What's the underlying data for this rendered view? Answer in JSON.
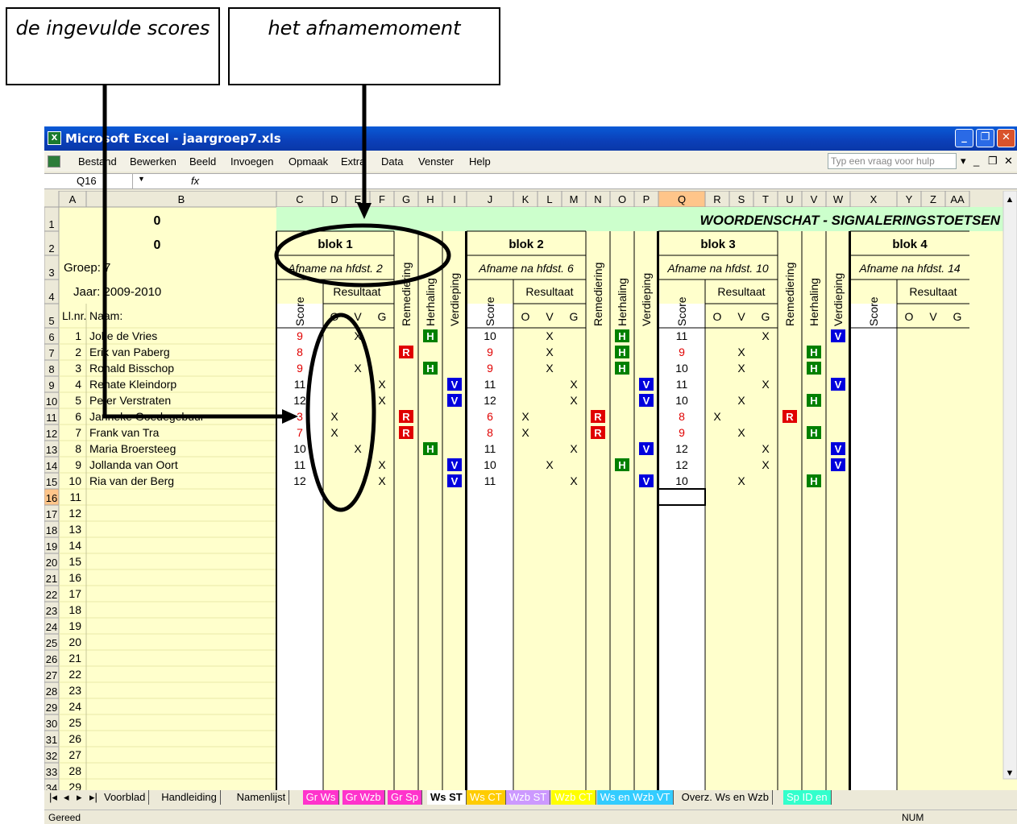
{
  "callouts": {
    "left": "de ingevulde scores",
    "right": "het afnamemoment"
  },
  "window": {
    "title": "Microsoft Excel - jaargroep7.xls"
  },
  "menu": [
    "Bestand",
    "Bewerken",
    "Beeld",
    "Invoegen",
    "Opmaak",
    "Extra",
    "Data",
    "Venster",
    "Help"
  ],
  "help_placeholder": "Typ een vraag voor hulp",
  "namebox": "Q16",
  "fx": "fx",
  "columns": [
    "A",
    "B",
    "C",
    "D",
    "E",
    "F",
    "G",
    "H",
    "I",
    "J",
    "K",
    "L",
    "M",
    "N",
    "O",
    "P",
    "Q",
    "R",
    "S",
    "T",
    "U",
    "V",
    "W",
    "X",
    "Y",
    "Z",
    "AA"
  ],
  "sheet": {
    "a1": "0",
    "a2": "0",
    "groep": "Groep: 7",
    "jaar": "Jaar: 2009-2010",
    "llnr": "Ll.nr.",
    "naam": "Naam:",
    "title": "WOORDENSCHAT - SIGNALERINGSTOETSEN",
    "blocks": [
      {
        "name": "blok 1",
        "afname": "Afname na hfdst. 2"
      },
      {
        "name": "blok 2",
        "afname": "Afname na hfdst. 6"
      },
      {
        "name": "blok 3",
        "afname": "Afname na hfdst. 10"
      },
      {
        "name": "blok 4",
        "afname": "Afname na hfdst. 14"
      }
    ],
    "score": "Score",
    "resultaat": "Resultaat",
    "o": "O",
    "v": "V",
    "g": "G",
    "remediering": "Remediering",
    "herhaling": "Herhaling",
    "verdieping": "Verdieping"
  },
  "students": [
    {
      "nr": "1",
      "name": "Joke de Vries",
      "b": [
        [
          "9",
          "V",
          "H"
        ],
        [
          "10",
          "V",
          "H"
        ],
        [
          "11",
          "G",
          "V"
        ]
      ]
    },
    {
      "nr": "2",
      "name": "Erik van Paberg",
      "b": [
        [
          "8",
          "",
          "R"
        ],
        [
          "9",
          "V",
          "H"
        ],
        [
          "9",
          "V",
          "H"
        ]
      ]
    },
    {
      "nr": "3",
      "name": "Ronald Bisschop",
      "b": [
        [
          "9",
          "V",
          "H"
        ],
        [
          "9",
          "V",
          "H"
        ],
        [
          "10",
          "V",
          "H"
        ]
      ]
    },
    {
      "nr": "4",
      "name": "Renate Kleindorp",
      "b": [
        [
          "11",
          "G",
          "V"
        ],
        [
          "11",
          "G",
          "V"
        ],
        [
          "11",
          "G",
          "V"
        ]
      ]
    },
    {
      "nr": "5",
      "name": "Peter Verstraten",
      "b": [
        [
          "12",
          "G",
          "V"
        ],
        [
          "12",
          "G",
          "V"
        ],
        [
          "10",
          "V",
          "H"
        ]
      ]
    },
    {
      "nr": "6",
      "name": "Janneke Goedegebuur",
      "b": [
        [
          "3",
          "O",
          "R"
        ],
        [
          "6",
          "O",
          "R"
        ],
        [
          "8",
          "O",
          "R"
        ]
      ]
    },
    {
      "nr": "7",
      "name": "Frank van Tra",
      "b": [
        [
          "7",
          "O",
          "R"
        ],
        [
          "8",
          "O",
          "R"
        ],
        [
          "9",
          "V",
          "H"
        ]
      ]
    },
    {
      "nr": "8",
      "name": "Maria Broersteeg",
      "b": [
        [
          "10",
          "V",
          "H"
        ],
        [
          "11",
          "G",
          "V"
        ],
        [
          "12",
          "G",
          "V"
        ]
      ]
    },
    {
      "nr": "9",
      "name": "Jollanda van Oort",
      "b": [
        [
          "11",
          "G",
          "V"
        ],
        [
          "10",
          "V",
          "H"
        ],
        [
          "12",
          "G",
          "V"
        ]
      ]
    },
    {
      "nr": "10",
      "name": "Ria van der Berg",
      "b": [
        [
          "12",
          "G",
          "V"
        ],
        [
          "11",
          "G",
          "V"
        ],
        [
          "10",
          "V",
          "H"
        ]
      ]
    }
  ],
  "empty_nrs": [
    "11",
    "12",
    "13",
    "14",
    "15",
    "16",
    "17",
    "18",
    "19",
    "20",
    "21",
    "22",
    "23",
    "24",
    "25",
    "26",
    "27",
    "28",
    "29"
  ],
  "tabs": [
    {
      "label": "Voorblad",
      "color": ""
    },
    {
      "label": "Handleiding",
      "color": ""
    },
    {
      "label": "Namenlijst",
      "color": ""
    },
    {
      "label": "Gr Ws",
      "color": "#ff33cc"
    },
    {
      "label": "Gr Wzb",
      "color": "#ff33cc"
    },
    {
      "label": "Gr Sp",
      "color": "#ff33cc"
    },
    {
      "label": "Ws ST",
      "color": ""
    },
    {
      "label": "Ws CT",
      "color": "#ffcc00"
    },
    {
      "label": "Wzb ST",
      "color": "#cc99ff"
    },
    {
      "label": "Wzb CT",
      "color": "#ffff00"
    },
    {
      "label": "Ws en Wzb VT",
      "color": "#33ccff"
    },
    {
      "label": "Overz. Ws en Wzb",
      "color": ""
    },
    {
      "label": "Sp ID en",
      "color": "#33ffcc"
    }
  ],
  "status": {
    "left": "Gereed",
    "num": "NUM"
  },
  "colors": {
    "yellow": "#ffffcc",
    "green_title": "#ccffcc",
    "red": "#e00000",
    "R": "#e00000",
    "H": "#008000",
    "V": "#0000dd"
  }
}
